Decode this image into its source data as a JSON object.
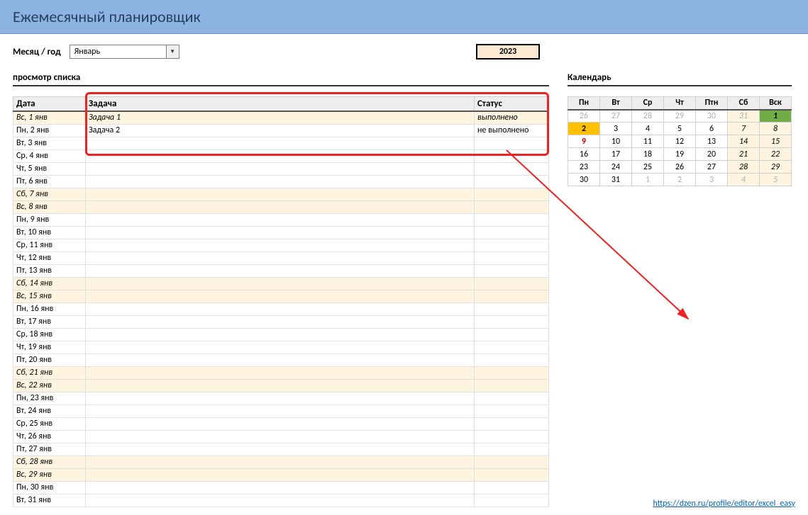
{
  "title": "Ежемесячный планировщик",
  "month_label": "Месяц / год",
  "month_value": "Январь",
  "year": "2023",
  "list_heading": "просмотр списка",
  "cal_heading": "Календарь",
  "footer_link": "https://dzen.ru/profile/editor/excel_easy",
  "list": {
    "col_date": "Дата",
    "col_task": "Задача",
    "col_status": "Статус",
    "rows": [
      {
        "date": "Вс, 1 янв",
        "task": "Задача 1",
        "status": "выполнено",
        "weekend": true
      },
      {
        "date": "Пн, 2 янв",
        "task": "Задача 2",
        "status": "не выполнено",
        "weekend": false
      },
      {
        "date": "Вт, 3 янв",
        "task": "",
        "status": "",
        "weekend": false
      },
      {
        "date": "Ср, 4 янв",
        "task": "",
        "status": "",
        "weekend": false
      },
      {
        "date": "Чт, 5 янв",
        "task": "",
        "status": "",
        "weekend": false
      },
      {
        "date": "Пт, 6 янв",
        "task": "",
        "status": "",
        "weekend": false
      },
      {
        "date": "Сб, 7 янв",
        "task": "",
        "status": "",
        "weekend": true
      },
      {
        "date": "Вс, 8 янв",
        "task": "",
        "status": "",
        "weekend": true
      },
      {
        "date": "Пн, 9 янв",
        "task": "",
        "status": "",
        "weekend": false
      },
      {
        "date": "Вт, 10 янв",
        "task": "",
        "status": "",
        "weekend": false
      },
      {
        "date": "Ср, 11 янв",
        "task": "",
        "status": "",
        "weekend": false
      },
      {
        "date": "Чт, 12 янв",
        "task": "",
        "status": "",
        "weekend": false
      },
      {
        "date": "Пт, 13 янв",
        "task": "",
        "status": "",
        "weekend": false
      },
      {
        "date": "Сб, 14 янв",
        "task": "",
        "status": "",
        "weekend": true
      },
      {
        "date": "Вс, 15 янв",
        "task": "",
        "status": "",
        "weekend": true
      },
      {
        "date": "Пн, 16 янв",
        "task": "",
        "status": "",
        "weekend": false
      },
      {
        "date": "Вт, 17 янв",
        "task": "",
        "status": "",
        "weekend": false
      },
      {
        "date": "Ср, 18 янв",
        "task": "",
        "status": "",
        "weekend": false
      },
      {
        "date": "Чт, 19 янв",
        "task": "",
        "status": "",
        "weekend": false
      },
      {
        "date": "Пт, 20 янв",
        "task": "",
        "status": "",
        "weekend": false
      },
      {
        "date": "Сб, 21 янв",
        "task": "",
        "status": "",
        "weekend": true
      },
      {
        "date": "Вс, 22 янв",
        "task": "",
        "status": "",
        "weekend": true
      },
      {
        "date": "Пн, 23 янв",
        "task": "",
        "status": "",
        "weekend": false
      },
      {
        "date": "Вт, 24 янв",
        "task": "",
        "status": "",
        "weekend": false
      },
      {
        "date": "Ср, 25 янв",
        "task": "",
        "status": "",
        "weekend": false
      },
      {
        "date": "Чт, 26 янв",
        "task": "",
        "status": "",
        "weekend": false
      },
      {
        "date": "Пт, 27 янв",
        "task": "",
        "status": "",
        "weekend": false
      },
      {
        "date": "Сб, 28 янв",
        "task": "",
        "status": "",
        "weekend": true
      },
      {
        "date": "Вс, 29 янв",
        "task": "",
        "status": "",
        "weekend": true
      },
      {
        "date": "Пн, 30 янв",
        "task": "",
        "status": "",
        "weekend": false
      },
      {
        "date": "Вт, 31 янв",
        "task": "",
        "status": "",
        "weekend": false
      }
    ]
  },
  "calendar": {
    "headers": [
      "Пн",
      "Вт",
      "Ср",
      "Чт",
      "Птн",
      "Сб",
      "Вск"
    ],
    "weeks": [
      [
        {
          "d": "26",
          "muted": true
        },
        {
          "d": "27",
          "muted": true
        },
        {
          "d": "28",
          "muted": true
        },
        {
          "d": "29",
          "muted": true
        },
        {
          "d": "30",
          "muted": true
        },
        {
          "d": "31",
          "muted": true,
          "wk": true
        },
        {
          "d": "1",
          "wk": true,
          "green": true
        }
      ],
      [
        {
          "d": "2",
          "today": true
        },
        {
          "d": "3"
        },
        {
          "d": "4"
        },
        {
          "d": "5"
        },
        {
          "d": "6"
        },
        {
          "d": "7",
          "wk": true
        },
        {
          "d": "8",
          "wk": true
        }
      ],
      [
        {
          "d": "9",
          "red": true
        },
        {
          "d": "10"
        },
        {
          "d": "11"
        },
        {
          "d": "12"
        },
        {
          "d": "13"
        },
        {
          "d": "14",
          "wk": true
        },
        {
          "d": "15",
          "wk": true
        }
      ],
      [
        {
          "d": "16"
        },
        {
          "d": "17"
        },
        {
          "d": "18"
        },
        {
          "d": "19"
        },
        {
          "d": "20"
        },
        {
          "d": "21",
          "wk": true
        },
        {
          "d": "22",
          "wk": true
        }
      ],
      [
        {
          "d": "23"
        },
        {
          "d": "24"
        },
        {
          "d": "25"
        },
        {
          "d": "26"
        },
        {
          "d": "27"
        },
        {
          "d": "28",
          "wk": true
        },
        {
          "d": "29",
          "wk": true
        }
      ],
      [
        {
          "d": "30"
        },
        {
          "d": "31"
        },
        {
          "d": "1",
          "muted": true
        },
        {
          "d": "2",
          "muted": true
        },
        {
          "d": "3",
          "muted": true
        },
        {
          "d": "4",
          "muted": true,
          "wk": true
        },
        {
          "d": "5",
          "muted": true,
          "wk": true
        }
      ]
    ]
  }
}
